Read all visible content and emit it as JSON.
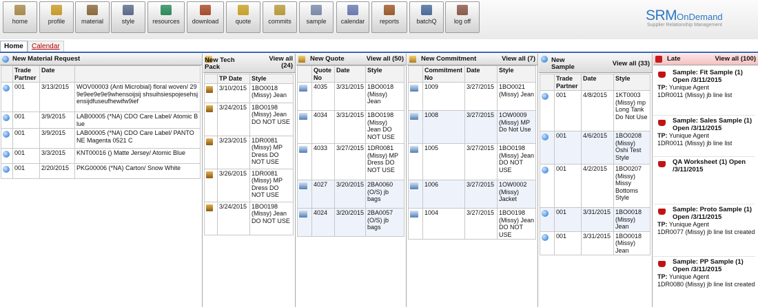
{
  "toolbar": [
    {
      "id": "home",
      "label": "home",
      "icon": "home-icon",
      "color": "#a88a4a"
    },
    {
      "id": "profile",
      "label": "profile",
      "icon": "person-icon",
      "color": "#c89a2a"
    },
    {
      "id": "material",
      "label": "material",
      "icon": "material-icon",
      "color": "#8a6a3a"
    },
    {
      "id": "style",
      "label": "style",
      "icon": "style-icon",
      "color": "#5a6a8a"
    },
    {
      "id": "resources",
      "label": "resources",
      "icon": "globe-icon",
      "color": "#2a8a5a"
    },
    {
      "id": "download",
      "label": "download",
      "icon": "download-icon",
      "color": "#a84a2a"
    },
    {
      "id": "quote",
      "label": "quote",
      "icon": "quote-icon",
      "color": "#c8a02a"
    },
    {
      "id": "commits",
      "label": "commits",
      "icon": "commit-icon",
      "color": "#b89a3a"
    },
    {
      "id": "sample",
      "label": "sample",
      "icon": "sample-icon",
      "color": "#7a8aa8"
    },
    {
      "id": "calendar",
      "label": "calendar",
      "icon": "calendar-icon",
      "color": "#6a7ab0"
    },
    {
      "id": "reports",
      "label": "reports",
      "icon": "reports-icon",
      "color": "#9a5a2a"
    },
    {
      "id": "batchq",
      "label": "batchQ",
      "icon": "batch-icon",
      "color": "#4a6a9a"
    },
    {
      "id": "logoff",
      "label": "log off",
      "icon": "logoff-icon",
      "color": "#8a5a4a"
    }
  ],
  "logo": {
    "brand": "SRM",
    "brand_suffix": "OnDemand",
    "subtitle": "Supplier Relationship Management"
  },
  "tabs": {
    "home": "Home",
    "calendar": "Calendar"
  },
  "material_panel": {
    "title": "New Material Request",
    "headers": [
      "",
      "Trade Partner",
      "Date",
      ""
    ],
    "rows": [
      {
        "tp": "001",
        "date": "3/13/2015",
        "desc": "WOV00003 (Anti Microbial) floral woven/ 299e9ee9e9e9whensoijsij shsuihsiespojesehsjensijdfuseufhewifw9ief"
      },
      {
        "tp": "001",
        "date": "3/9/2015",
        "desc": "LAB00005 (*NA) CDO Care Label/ Atomic Blue"
      },
      {
        "tp": "001",
        "date": "3/9/2015",
        "desc": "LAB00005 (*NA) CDO Care Label/ PANTONE Magenta 0521 C"
      },
      {
        "tp": "001",
        "date": "3/3/2015",
        "desc": "KNT00016 () Matte Jersey/ Atomic Blue"
      },
      {
        "tp": "001",
        "date": "2/20/2015",
        "desc": "PKG00006 (*NA) Carton/ Snow White"
      }
    ]
  },
  "techpack_panel": {
    "title": "New Tech Pack",
    "view_all": "View all (24)",
    "headers": [
      "",
      "TP Date",
      "Style"
    ],
    "rows": [
      {
        "date": "3/10/2015",
        "style": "1BO0018 (Missy) Jean"
      },
      {
        "date": "3/24/2015",
        "style": "1BO0198 (Missy) Jean DO NOT USE"
      },
      {
        "date": "3/23/2015",
        "style": "1DR0081 (Missy) MP Dress DO NOT USE"
      },
      {
        "date": "3/26/2015",
        "style": "1DR0081 (Missy) MP Dress DO NOT USE"
      },
      {
        "date": "3/24/2015",
        "style": "1BO0198 (Missy) Jean DO NOT USE"
      }
    ]
  },
  "quote_panel": {
    "title": "New Quote",
    "view_all": "View all (50)",
    "headers": [
      "",
      "Quote No",
      "Date",
      "Style"
    ],
    "rows": [
      {
        "no": "4035",
        "date": "3/31/2015",
        "style": "1BO0018 (Missy) Jean"
      },
      {
        "no": "4034",
        "date": "3/31/2015",
        "style": "1BO0198 (Missy) Jean DO NOT USE"
      },
      {
        "no": "4033",
        "date": "3/27/2015",
        "style": "1DR0081 (Missy) MP Dress DO NOT USE"
      },
      {
        "no": "4027",
        "date": "3/20/2015",
        "style": "2BA0060 (O/S) jb bags"
      },
      {
        "no": "4024",
        "date": "3/20/2015",
        "style": "2BA0057 (O/S) jb bags"
      }
    ]
  },
  "commitment_panel": {
    "title": "New Commitment",
    "view_all": "View all (7)",
    "headers": [
      "",
      "Commitment No",
      "Date",
      "Style"
    ],
    "rows": [
      {
        "no": "1009",
        "date": "3/27/2015",
        "style": "1BO0021 (Missy) Jean"
      },
      {
        "no": "1008",
        "date": "3/27/2015",
        "style": "1OW0009 (Missy) MP Do Not Use"
      },
      {
        "no": "1005",
        "date": "3/27/2015",
        "style": "1BO0198 (Missy) Jean DO NOT USE"
      },
      {
        "no": "1006",
        "date": "3/27/2015",
        "style": "1OW0002 (Missy) Jacket"
      },
      {
        "no": "1004",
        "date": "3/27/2015",
        "style": "1BO0198 (Missy) Jean DO NOT USE"
      }
    ]
  },
  "sample_panel": {
    "title": "New Sample",
    "view_all": "View all (33)",
    "headers": [
      "",
      "Trade Partner",
      "Date",
      "Style"
    ],
    "rows": [
      {
        "tp": "001",
        "date": "4/8/2015",
        "style": "1KT0003 (Missy) mp Long Tank Do Not Use"
      },
      {
        "tp": "001",
        "date": "4/6/2015",
        "style": "1BO0208 (Missy) Oshi Test Style"
      },
      {
        "tp": "001",
        "date": "4/2/2015",
        "style": "1BO0207 (Missy) Missy Bottoms Style"
      },
      {
        "tp": "001",
        "date": "3/31/2015",
        "style": "1BO0018 (Missy) Jean"
      },
      {
        "tp": "001",
        "date": "3/31/2015",
        "style": "1BO0018 (Missy) Jean"
      }
    ]
  },
  "late_panel": {
    "title": "Late",
    "view_all": "View all (100)",
    "items": [
      {
        "title": "Sample: Fit Sample (1) Open /3/11/2015",
        "tp_label": "TP:",
        "tp": "Yunique Agent",
        "desc": "1DR0011 (Missy) jb line list"
      },
      {
        "title": "Sample: Sales Sample (1) Open /3/11/2015",
        "tp_label": "TP:",
        "tp": "Yunique Agent",
        "desc": "1DR0011 (Missy) jb line list"
      },
      {
        "title": "QA Worksheet (1) Open /3/11/2015",
        "tp_label": "",
        "tp": "",
        "desc": ""
      },
      {
        "title": "Sample: Proto Sample (1) Open /3/11/2015",
        "tp_label": "TP:",
        "tp": "Yunique Agent",
        "desc": "1DR0077 (Missy) jb line list created"
      },
      {
        "title": "Sample: PP Sample (1) Open /3/11/2015",
        "tp_label": "TP:",
        "tp": "Yunique Agent",
        "desc": "1DR0080 (Missy) jb line list created"
      }
    ]
  }
}
